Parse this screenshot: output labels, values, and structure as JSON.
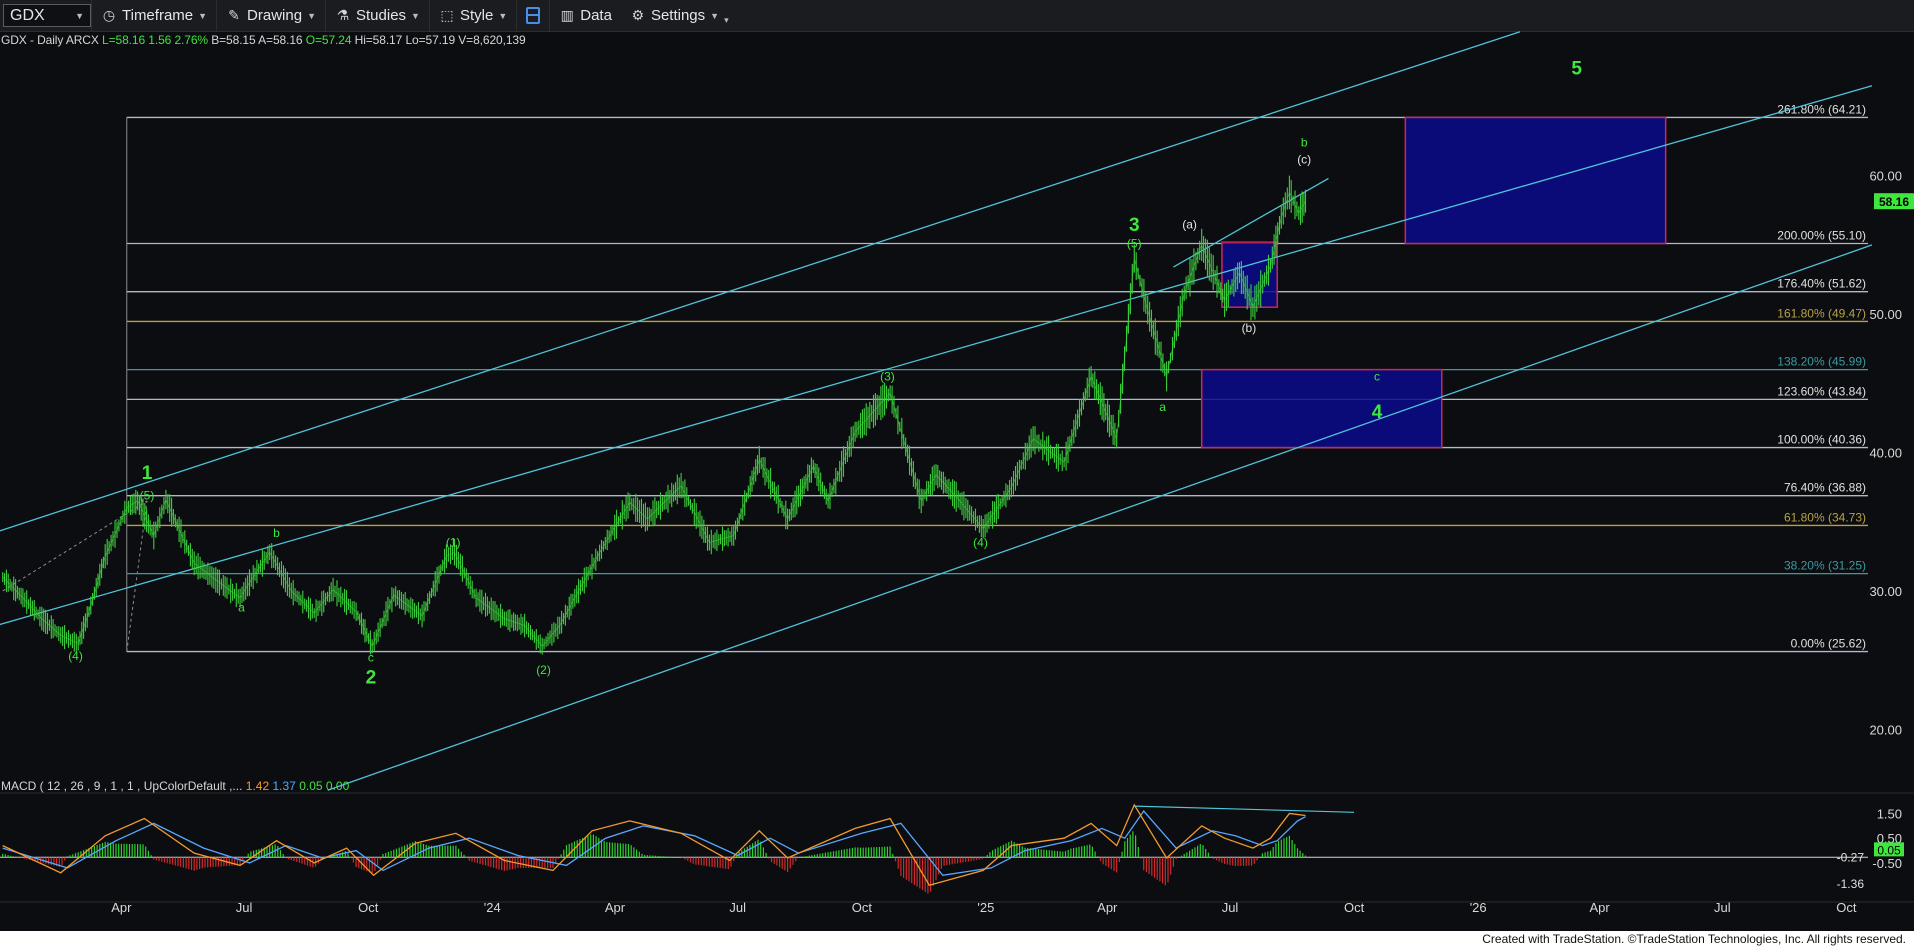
{
  "toolbar": {
    "symbol": "GDX",
    "timeframe": "Timeframe",
    "drawing": "Drawing",
    "studies": "Studies",
    "style": "Style",
    "data": "Data",
    "settings": "Settings"
  },
  "info": {
    "symbol": "GDX - Daily",
    "exchange": "ARCX",
    "last": "L=58.16",
    "change": "1.56",
    "pct": "2.76%",
    "bid": "B=58.15",
    "ask": "A=58.16",
    "open": "O=57.24",
    "high": "Hi=58.17",
    "low": "Lo=57.19",
    "volume": "V=8,620,139"
  },
  "macd_header": {
    "label": "MACD ( 12 , 26 , 9 , 1 , 1 , UpColorDefault ,...",
    "v1": "1.42",
    "v2": "1.37",
    "v3": "0.05",
    "v4": "0.00"
  },
  "credit": "Created with TradeStation. ©TradeStation Technologies, Inc. All rights reserved.",
  "colors": {
    "background": "#0c0d10",
    "price": "#3ccf3c",
    "channel": "#4fc3d9",
    "fib_line": "#aeb9cc",
    "fib_gold": "#b6a245",
    "fib_teal": "#3a9aa0",
    "box_fill": "#0a0a8c",
    "box_border": "#d0245a",
    "wave_label": "#3ee63e",
    "macd": "#f39a2e",
    "signal": "#58a7ff",
    "hist_pos": "#2fd02f",
    "hist_neg": "#d02a2a",
    "last_price_tag": "#3ee63e"
  },
  "chart_data": {
    "type": "line",
    "title": "GDX - Daily",
    "y_axis": {
      "ticks": [
        20,
        30,
        40,
        50,
        60
      ],
      "labels": [
        "20.00",
        "30.00",
        "40.00",
        "50.00",
        "60.00"
      ],
      "range": [
        16.7,
        69.3
      ]
    },
    "x_axis": {
      "labels": [
        "Apr",
        "Jul",
        "Oct",
        "'24",
        "Apr",
        "Jul",
        "Oct",
        "'25",
        "Apr",
        "Jul",
        "Oct",
        "'26",
        "Apr",
        "Jul",
        "Oct"
      ],
      "label_dates": [
        "2023-04-01",
        "2023-07-01",
        "2023-10-01",
        "2024-01-01",
        "2024-04-01",
        "2024-07-01",
        "2024-10-01",
        "2025-01-01",
        "2025-04-01",
        "2025-07-01",
        "2025-10-01",
        "2026-01-01",
        "2026-04-01",
        "2026-07-01",
        "2026-10-01"
      ],
      "range": [
        "2023-01-01",
        "2026-10-20"
      ]
    },
    "last_price": {
      "value": 58.16,
      "label": "58.16"
    },
    "price_series": {
      "name": "GDX",
      "points": [
        [
          "2023-01-03",
          31.0
        ],
        [
          "2023-01-18",
          29.5
        ],
        [
          "2023-02-01",
          28.0
        ],
        [
          "2023-02-15",
          26.8
        ],
        [
          "2023-02-28",
          26.2
        ],
        [
          "2023-03-08",
          28.5
        ],
        [
          "2023-03-20",
          32.5
        ],
        [
          "2023-04-05",
          36.0
        ],
        [
          "2023-04-13",
          36.5
        ],
        [
          "2023-04-25",
          34.0
        ],
        [
          "2023-05-04",
          36.6
        ],
        [
          "2023-05-25",
          32.0
        ],
        [
          "2023-06-10",
          30.8
        ],
        [
          "2023-06-28",
          29.5
        ],
        [
          "2023-07-05",
          30.6
        ],
        [
          "2023-07-20",
          32.8
        ],
        [
          "2023-08-05",
          30.0
        ],
        [
          "2023-08-22",
          28.4
        ],
        [
          "2023-09-05",
          30.1
        ],
        [
          "2023-09-22",
          28.5
        ],
        [
          "2023-10-04",
          26.0
        ],
        [
          "2023-10-20",
          29.7
        ],
        [
          "2023-11-10",
          28.2
        ],
        [
          "2023-11-28",
          32.5
        ],
        [
          "2023-12-04",
          32.8
        ],
        [
          "2023-12-20",
          29.5
        ],
        [
          "2024-01-10",
          28.0
        ],
        [
          "2024-01-25",
          27.5
        ],
        [
          "2024-02-07",
          26.0
        ],
        [
          "2024-02-20",
          27.5
        ],
        [
          "2024-03-05",
          30.0
        ],
        [
          "2024-03-22",
          33.0
        ],
        [
          "2024-04-12",
          36.4
        ],
        [
          "2024-04-25",
          35.2
        ],
        [
          "2024-05-20",
          37.6
        ],
        [
          "2024-06-10",
          33.5
        ],
        [
          "2024-06-28",
          34.0
        ],
        [
          "2024-07-17",
          39.5
        ],
        [
          "2024-08-07",
          35.2
        ],
        [
          "2024-08-26",
          39.0
        ],
        [
          "2024-09-06",
          36.5
        ],
        [
          "2024-09-26",
          41.5
        ],
        [
          "2024-10-22",
          44.3
        ],
        [
          "2024-11-14",
          36.5
        ],
        [
          "2024-11-25",
          38.4
        ],
        [
          "2024-12-10",
          36.8
        ],
        [
          "2024-12-30",
          34.5
        ],
        [
          "2025-01-20",
          37.5
        ],
        [
          "2025-02-05",
          41.0
        ],
        [
          "2025-02-28",
          39.3
        ],
        [
          "2025-03-20",
          45.5
        ],
        [
          "2025-04-08",
          41.0
        ],
        [
          "2025-04-21",
          54.0
        ],
        [
          "2025-05-01",
          50.3
        ],
        [
          "2025-05-15",
          45.5
        ],
        [
          "2025-05-28",
          51.5
        ],
        [
          "2025-06-10",
          55.0
        ],
        [
          "2025-06-27",
          51.0
        ],
        [
          "2025-07-08",
          53.0
        ],
        [
          "2025-07-18",
          50.5
        ],
        [
          "2025-07-31",
          53.5
        ],
        [
          "2025-08-08",
          57.0
        ],
        [
          "2025-08-14",
          58.8
        ],
        [
          "2025-08-21",
          57.3
        ],
        [
          "2025-08-26",
          58.16
        ]
      ]
    },
    "fib_levels": [
      {
        "pct": "261.80%",
        "value": 64.21,
        "label": "261.80% (64.21)",
        "style": "line"
      },
      {
        "pct": "200.00%",
        "value": 55.1,
        "label": "200.00% (55.10)",
        "style": "line"
      },
      {
        "pct": "176.40%",
        "value": 51.62,
        "label": "176.40% (51.62)",
        "style": "line"
      },
      {
        "pct": "161.80%",
        "value": 49.47,
        "label": "161.80% (49.47)",
        "style": "gold"
      },
      {
        "pct": "138.20%",
        "value": 45.99,
        "label": "138.20% (45.99)",
        "style": "teal"
      },
      {
        "pct": "123.60%",
        "value": 43.84,
        "label": "123.60% (43.84)",
        "style": "line"
      },
      {
        "pct": "100.00%",
        "value": 40.36,
        "label": "100.00% (40.36)",
        "style": "line"
      },
      {
        "pct": "76.40%",
        "value": 36.88,
        "label": "76.40% (36.88)",
        "style": "line"
      },
      {
        "pct": "61.80%",
        "value": 34.73,
        "label": "61.80% (34.73)",
        "style": "gold"
      },
      {
        "pct": "38.20%",
        "value": 31.25,
        "label": "38.20% (31.25)",
        "style": "teal"
      },
      {
        "pct": "0.00%",
        "value": 25.62,
        "label": "0.00% (25.62)",
        "style": "line"
      }
    ],
    "target_boxes": [
      {
        "x": [
          "2025-11-08",
          "2026-05-20"
        ],
        "y": [
          55.1,
          64.21
        ]
      },
      {
        "x": [
          "2025-06-10",
          "2025-12-05"
        ],
        "y": [
          40.36,
          45.99
        ]
      },
      {
        "x": [
          "2025-06-25",
          "2025-08-05"
        ],
        "y": [
          50.5,
          55.2
        ]
      }
    ],
    "channels": [
      {
        "from": [
          "2022-12-15",
          33.8
        ],
        "to": [
          "2026-02-01",
          70.4
        ]
      },
      {
        "from": [
          "2022-12-15",
          27.1
        ],
        "to": [
          "2026-10-20",
          66.5
        ]
      },
      {
        "from": [
          "2023-09-01",
          15.6
        ],
        "to": [
          "2026-10-20",
          55.0
        ]
      },
      {
        "from": [
          "2025-05-20",
          53.4
        ],
        "to": [
          "2025-09-12",
          59.8
        ]
      }
    ],
    "wave_labels": [
      {
        "text": "1",
        "date": "2023-04-20",
        "value": 38.1,
        "size": "big"
      },
      {
        "text": "(5)",
        "date": "2023-04-20",
        "value": 36.6,
        "size": "small"
      },
      {
        "text": "(4)",
        "date": "2023-02-26",
        "value": 25.0,
        "size": "small"
      },
      {
        "text": "b",
        "date": "2023-07-25",
        "value": 33.9,
        "size": "small"
      },
      {
        "text": "a",
        "date": "2023-06-29",
        "value": 28.5,
        "size": "small"
      },
      {
        "text": "c",
        "date": "2023-10-03",
        "value": 24.9,
        "size": "small"
      },
      {
        "text": "2",
        "date": "2023-10-03",
        "value": 23.3,
        "size": "big"
      },
      {
        "text": "(1)",
        "date": "2023-12-03",
        "value": 33.2,
        "size": "small"
      },
      {
        "text": "(2)",
        "date": "2024-02-08",
        "value": 24.0,
        "size": "small"
      },
      {
        "text": "(3)",
        "date": "2024-10-20",
        "value": 45.2,
        "size": "small"
      },
      {
        "text": "(4)",
        "date": "2024-12-28",
        "value": 33.2,
        "size": "small"
      },
      {
        "text": "3",
        "date": "2025-04-21",
        "value": 56.0,
        "size": "big"
      },
      {
        "text": "(5)",
        "date": "2025-04-21",
        "value": 54.8,
        "size": "small"
      },
      {
        "text": "a",
        "date": "2025-05-12",
        "value": 43.0,
        "size": "small"
      },
      {
        "text": "(a)",
        "date": "2025-06-01",
        "value": 56.2,
        "size": "small",
        "color": "white"
      },
      {
        "text": "(b)",
        "date": "2025-07-15",
        "value": 48.7,
        "size": "small",
        "color": "white"
      },
      {
        "text": "b",
        "date": "2025-08-25",
        "value": 62.1,
        "size": "small"
      },
      {
        "text": "(c)",
        "date": "2025-08-25",
        "value": 60.9,
        "size": "small",
        "color": "white"
      },
      {
        "text": "c",
        "date": "2025-10-18",
        "value": 45.2,
        "size": "small"
      },
      {
        "text": "4",
        "date": "2025-10-18",
        "value": 42.5,
        "size": "big"
      },
      {
        "text": "5",
        "date": "2026-03-15",
        "value": 67.3,
        "size": "big"
      }
    ],
    "macd": {
      "name": "MACD",
      "y_ticks": [
        1.5,
        0.5,
        -0.5
      ],
      "y_tick_labels": [
        "1.50",
        "0.50",
        "-0.50"
      ],
      "range": [
        -2.0,
        2.25
      ],
      "readouts": [
        {
          "value": -0.27,
          "label": "-0.27",
          "color": "white"
        },
        {
          "value": 0.05,
          "label": "0.05",
          "color": "green"
        },
        {
          "value": -1.36,
          "label": "-1.36",
          "color": "white"
        }
      ],
      "zero_line": -0.27,
      "divergence_line": {
        "from": [
          "2025-04-21",
          1.8
        ],
        "to": [
          "2025-10-01",
          1.55
        ]
      },
      "series": [
        {
          "name": "MACD",
          "points": [
            [
              "2023-01-03",
              0.2
            ],
            [
              "2023-02-15",
              -0.9
            ],
            [
              "2023-03-20",
              0.6
            ],
            [
              "2023-04-18",
              1.3
            ],
            [
              "2023-05-25",
              -0.1
            ],
            [
              "2023-06-28",
              -0.6
            ],
            [
              "2023-07-25",
              0.4
            ],
            [
              "2023-08-22",
              -0.5
            ],
            [
              "2023-09-15",
              0.1
            ],
            [
              "2023-10-05",
              -1.0
            ],
            [
              "2023-11-05",
              0.3
            ],
            [
              "2023-12-05",
              0.7
            ],
            [
              "2024-01-10",
              -0.4
            ],
            [
              "2024-02-15",
              -0.8
            ],
            [
              "2024-03-15",
              0.8
            ],
            [
              "2024-04-12",
              1.2
            ],
            [
              "2024-05-20",
              0.7
            ],
            [
              "2024-06-25",
              -0.4
            ],
            [
              "2024-07-17",
              0.8
            ],
            [
              "2024-08-07",
              -0.3
            ],
            [
              "2024-09-26",
              0.9
            ],
            [
              "2024-10-22",
              1.3
            ],
            [
              "2024-11-20",
              -1.4
            ],
            [
              "2024-12-30",
              -0.8
            ],
            [
              "2025-01-20",
              0.2
            ],
            [
              "2025-02-28",
              0.5
            ],
            [
              "2025-03-20",
              1.1
            ],
            [
              "2025-04-08",
              0.2
            ],
            [
              "2025-04-21",
              1.85
            ],
            [
              "2025-05-15",
              -0.3
            ],
            [
              "2025-06-10",
              1.0
            ],
            [
              "2025-06-27",
              0.5
            ],
            [
              "2025-07-18",
              0.1
            ],
            [
              "2025-07-31",
              0.5
            ],
            [
              "2025-08-14",
              1.5
            ],
            [
              "2025-08-26",
              1.42
            ]
          ]
        },
        {
          "name": "Signal",
          "points": [
            [
              "2023-01-03",
              0.1
            ],
            [
              "2023-02-20",
              -0.7
            ],
            [
              "2023-03-28",
              0.4
            ],
            [
              "2023-04-25",
              1.1
            ],
            [
              "2023-06-01",
              0.1
            ],
            [
              "2023-07-05",
              -0.5
            ],
            [
              "2023-08-01",
              0.2
            ],
            [
              "2023-08-28",
              -0.3
            ],
            [
              "2023-09-22",
              0.0
            ],
            [
              "2023-10-12",
              -0.8
            ],
            [
              "2023-11-15",
              0.1
            ],
            [
              "2023-12-15",
              0.5
            ],
            [
              "2024-01-20",
              -0.2
            ],
            [
              "2024-02-25",
              -0.6
            ],
            [
              "2024-03-25",
              0.5
            ],
            [
              "2024-04-22",
              1.0
            ],
            [
              "2024-05-30",
              0.6
            ],
            [
              "2024-07-01",
              -0.2
            ],
            [
              "2024-07-25",
              0.5
            ],
            [
              "2024-08-15",
              -0.1
            ],
            [
              "2024-10-01",
              0.7
            ],
            [
              "2024-10-30",
              1.1
            ],
            [
              "2024-11-30",
              -1.0
            ],
            [
              "2025-01-05",
              -0.7
            ],
            [
              "2025-01-30",
              0.0
            ],
            [
              "2025-03-05",
              0.4
            ],
            [
              "2025-03-28",
              0.9
            ],
            [
              "2025-04-14",
              0.5
            ],
            [
              "2025-04-28",
              1.6
            ],
            [
              "2025-05-22",
              0.1
            ],
            [
              "2025-06-18",
              0.8
            ],
            [
              "2025-07-05",
              0.6
            ],
            [
              "2025-07-25",
              0.2
            ],
            [
              "2025-08-05",
              0.4
            ],
            [
              "2025-08-20",
              1.2
            ],
            [
              "2025-08-26",
              1.37
            ]
          ]
        }
      ]
    }
  }
}
